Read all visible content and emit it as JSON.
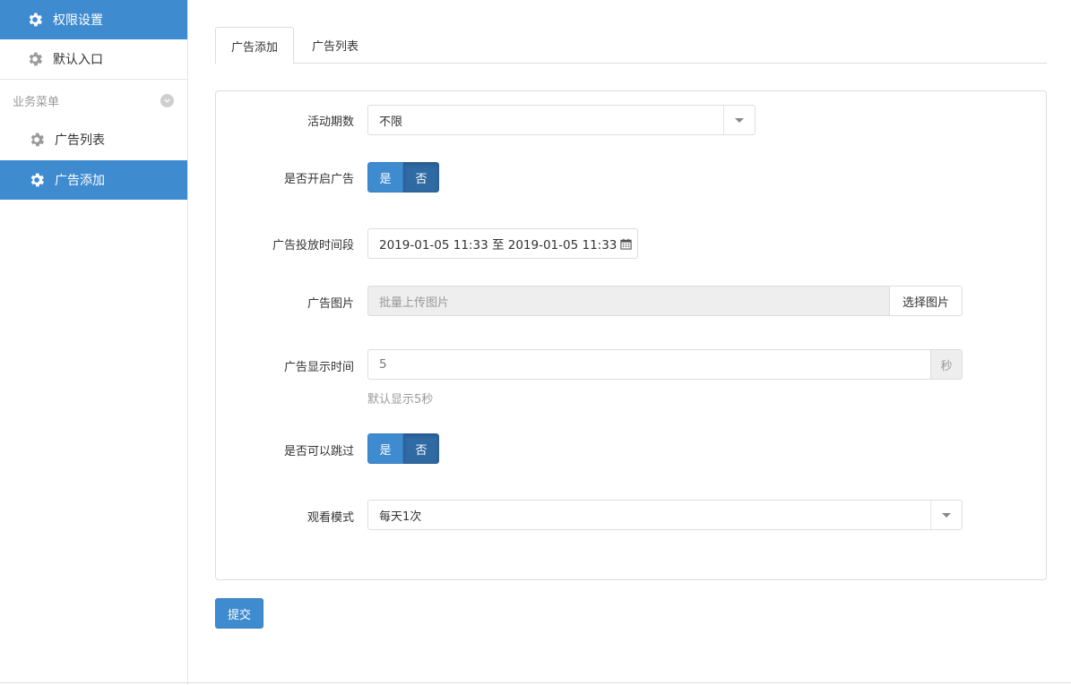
{
  "sidebar": {
    "items_top": [
      {
        "label": "权限设置",
        "icon": "gear-icon",
        "active": true
      },
      {
        "label": "默认入口",
        "icon": "gear-icon",
        "active": false
      }
    ],
    "group_label": "业务菜单",
    "group_toggle_icon": "chevron-down-icon",
    "items_group": [
      {
        "label": "广告列表",
        "icon": "gear-icon",
        "active": false
      },
      {
        "label": "广告添加",
        "icon": "gear-icon",
        "active": true
      }
    ]
  },
  "tabs": [
    {
      "label": "广告添加",
      "active": true
    },
    {
      "label": "广告列表",
      "active": false
    }
  ],
  "form": {
    "period": {
      "label": "活动期数",
      "value": "不限"
    },
    "enable_ad": {
      "label": "是否开启广告",
      "yes": "是",
      "no": "否",
      "selected": "否"
    },
    "time_range": {
      "label": "广告投放时间段",
      "value": "2019-01-05 11:33 至 2019-01-05 11:33",
      "icon": "calendar-icon"
    },
    "image": {
      "label": "广告图片",
      "placeholder": "批量上传图片",
      "button": "选择图片"
    },
    "display_time": {
      "label": "广告显示时间",
      "value": "5",
      "unit": "秒",
      "help": "默认显示5秒"
    },
    "skippable": {
      "label": "是否可以跳过",
      "yes": "是",
      "no": "否",
      "selected": "否"
    },
    "watch_mode": {
      "label": "观看模式",
      "value": "每天1次"
    }
  },
  "submit_label": "提交",
  "colors": {
    "primary": "#3f8bd0",
    "primary_dark": "#2f6aa3",
    "border": "#dddddd",
    "muted": "#999999"
  }
}
